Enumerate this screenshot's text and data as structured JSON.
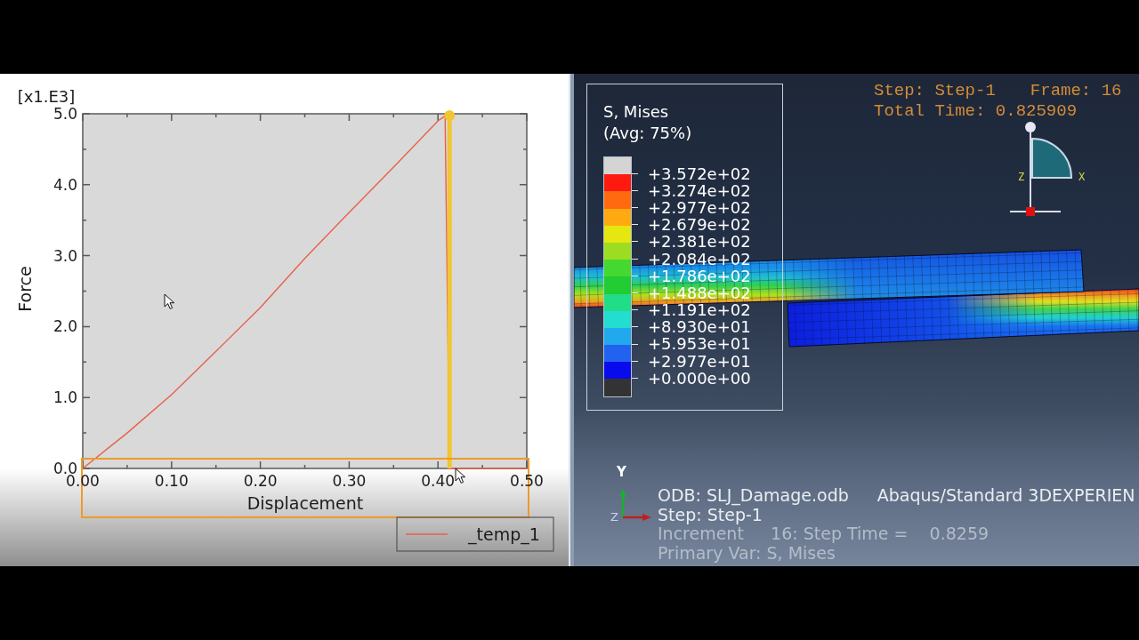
{
  "plot_panel": {
    "multiplier_label": "[x1.E3]",
    "selection_box": true,
    "chart_data": [
      {
        "type": "line",
        "xlabel": "Displacement",
        "ylabel": "Force",
        "xlim": [
          0,
          0.5
        ],
        "ylim": [
          0,
          5
        ],
        "xticks": [
          {
            "value": 0,
            "label": "0.00"
          },
          {
            "value": 0.1,
            "label": "0.10"
          },
          {
            "value": 0.2,
            "label": "0.20"
          },
          {
            "value": 0.3,
            "label": "0.30"
          },
          {
            "value": 0.4,
            "label": "0.40"
          },
          {
            "value": 0.5,
            "label": "0.50"
          }
        ],
        "yticks": [
          {
            "value": 0,
            "label": "0.0"
          },
          {
            "value": 1,
            "label": "1.0"
          },
          {
            "value": 2,
            "label": "2.0"
          },
          {
            "value": 3,
            "label": "3.0"
          },
          {
            "value": 4,
            "label": "4.0"
          },
          {
            "value": 5,
            "label": "5.0"
          }
        ],
        "x": [
          0,
          0.05,
          0.1,
          0.15,
          0.2,
          0.25,
          0.3,
          0.35,
          0.4,
          0.408,
          0.413,
          0.45,
          0.5
        ],
        "series": [
          {
            "name": "_temp_1",
            "color": "#e8604a",
            "values": [
              0,
              0.5,
              1.04,
              1.65,
              2.27,
              2.96,
              3.61,
              4.25,
              4.9,
              4.97,
              0,
              0,
              0
            ]
          }
        ],
        "ref_lines": [
          {
            "axis": "x",
            "value": 0.413,
            "color": "#f2c531"
          }
        ],
        "legend": "bottom-right"
      }
    ]
  },
  "viewport": {
    "contour_legend": {
      "title": "S, Mises",
      "subtitle": "(Avg: 75%)",
      "bands": [
        {
          "color": "#d4d4d4"
        },
        {
          "color": "#ff1a10"
        },
        {
          "color": "#ff6a10"
        },
        {
          "color": "#ffaa10"
        },
        {
          "color": "#e6e610"
        },
        {
          "color": "#9cdd22"
        },
        {
          "color": "#44d830"
        },
        {
          "color": "#22cc33"
        },
        {
          "color": "#22dd88"
        },
        {
          "color": "#22ddd0"
        },
        {
          "color": "#22a8ee"
        },
        {
          "color": "#2262ee"
        },
        {
          "color": "#0a0aee"
        },
        {
          "color": "#333333"
        }
      ],
      "labels": [
        "+3.572e+02",
        "+3.274e+02",
        "+2.977e+02",
        "+2.679e+02",
        "+2.381e+02",
        "+2.084e+02",
        "+1.786e+02",
        "+1.488e+02",
        "+1.191e+02",
        "+8.930e+01",
        "+5.953e+01",
        "+2.977e+01",
        "+0.000e+00"
      ]
    },
    "step_label": "Step: Step-1",
    "frame_label": "Frame: 16",
    "total_time": "Total Time: 0.825909",
    "compass_labels": [
      "Z",
      "X"
    ],
    "triad_labels": [
      "Y",
      "Z"
    ],
    "info_lines": [
      {
        "texts": [
          "ODB: SLJ_Damage.odb",
          "Abaqus/Standard 3DEXPERIEN"
        ],
        "dimmed": false
      },
      {
        "texts": [
          "Step: Step-1"
        ],
        "dimmed": false
      },
      {
        "texts": [
          "Increment     16: Step Time =    0.8259"
        ],
        "dimmed": true
      },
      {
        "texts": [
          "Primary Var: S, Mises"
        ],
        "dimmed": true
      }
    ]
  }
}
